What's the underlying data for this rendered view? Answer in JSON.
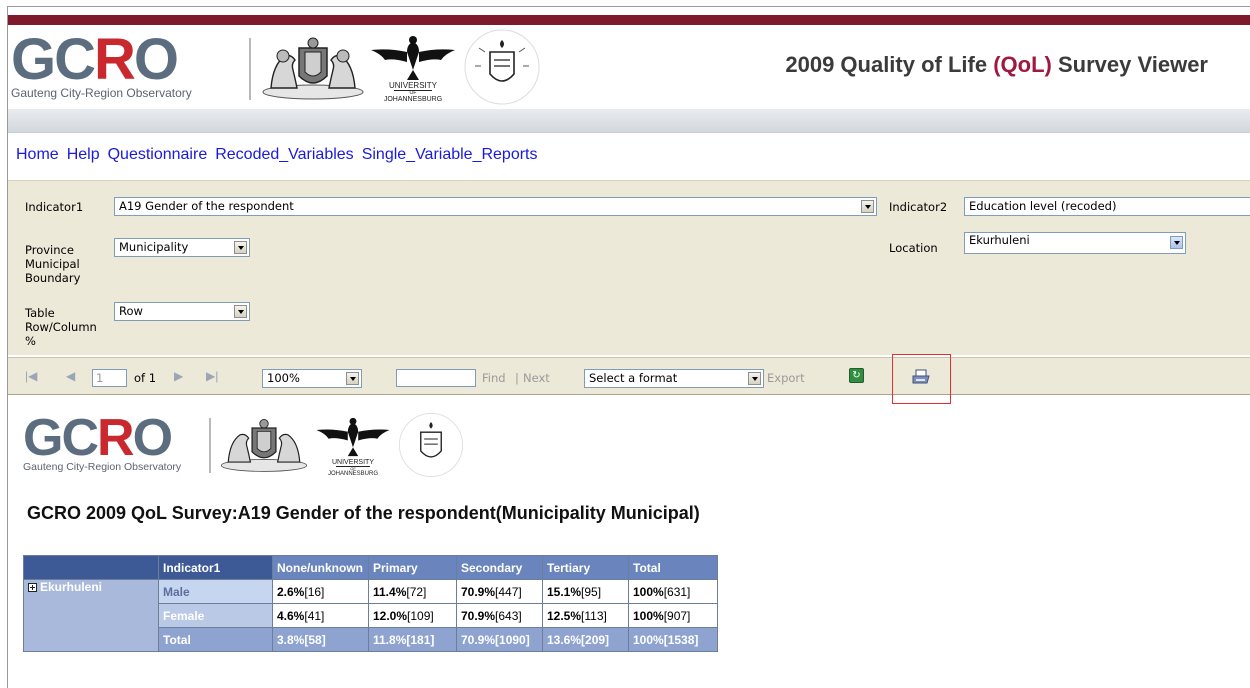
{
  "header": {
    "org_letters": [
      "G",
      "C",
      "R",
      "O"
    ],
    "org_name": "Gauteng City-Region Observatory",
    "uj_label_top": "UNIVERSITY",
    "uj_label_mid": "OF",
    "uj_label_bottom": "JOHANNESBURG",
    "title_prefix": "2009 Quality of Life ",
    "title_accent": "(QoL)",
    "title_suffix": " Survey Viewer",
    "accent_color": "#a01840",
    "bar_color": "#7d1a2c"
  },
  "nav": {
    "items": [
      "Home",
      "Help",
      "Questionnaire",
      "Recoded_Variables",
      "Single_Variable_Reports"
    ]
  },
  "params": {
    "indicator1_label": "Indicator1",
    "indicator1_value": "A19 Gender of the respondent",
    "indicator2_label": "Indicator2",
    "indicator2_value": "Education level (recoded)",
    "boundary_label_1": "Province",
    "boundary_label_2": "Municipal",
    "boundary_label_3": "Boundary",
    "boundary_value": "Municipality",
    "location_label": "Location",
    "location_value": "Ekurhuleni",
    "pct_label_1": "Table",
    "pct_label_2": "Row/Column",
    "pct_label_3": "%",
    "pct_value": "Row"
  },
  "toolbar": {
    "page_value": "1",
    "page_of": "of 1",
    "zoom_value": "100%",
    "find_label": "Find",
    "separator": "|",
    "next_label": "Next",
    "format_value": "Select a format",
    "export_label": "Export"
  },
  "report": {
    "title": "GCRO 2009 QoL Survey:A19 Gender of the respondent(Municipality Municipal)",
    "table": {
      "header_corner": "",
      "indicator_header": "Indicator1",
      "columns": [
        "None/unknown",
        "Primary",
        "Secondary",
        "Tertiary",
        "Total"
      ],
      "location": "Ekurhuleni",
      "rows": [
        {
          "label": "Male",
          "cells": [
            [
              "2.6%",
              "[16]"
            ],
            [
              "11.4%",
              "[72]"
            ],
            [
              "70.9%",
              "[447]"
            ],
            [
              "15.1%",
              "[95]"
            ],
            [
              "100%",
              "[631]"
            ]
          ]
        },
        {
          "label": "Female",
          "cells": [
            [
              "4.6%",
              "[41]"
            ],
            [
              "12.0%",
              "[109]"
            ],
            [
              "70.9%",
              "[643]"
            ],
            [
              "12.5%",
              "[113]"
            ],
            [
              "100%",
              "[907]"
            ]
          ]
        },
        {
          "label": "Total",
          "cells": [
            [
              "3.8%",
              "[58]"
            ],
            [
              "11.8%",
              "[181]"
            ],
            [
              "70.9%",
              "[1090]"
            ],
            [
              "13.6%",
              "[209]"
            ],
            [
              "100%",
              "[1538]"
            ]
          ]
        }
      ]
    }
  }
}
